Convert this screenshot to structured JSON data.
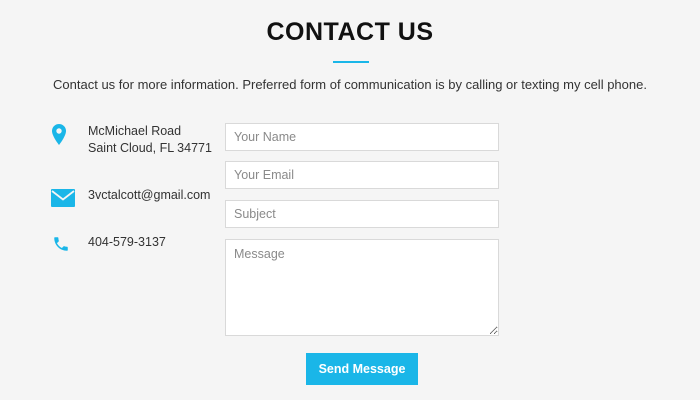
{
  "header": {
    "title": "CONTACT US",
    "subtitle": "Contact us for more information. Preferred form of communication is by calling or texting my cell phone."
  },
  "contact_info": {
    "address_line1": "McMichael Road",
    "address_line2": "Saint Cloud, FL 34771",
    "email": "3vctalcott@gmail.com",
    "phone": "404-579-3137"
  },
  "form": {
    "name_placeholder": "Your Name",
    "email_placeholder": "Your Email",
    "subject_placeholder": "Subject",
    "message_placeholder": "Message",
    "send_label": "Send Message"
  },
  "colors": {
    "accent": "#1ab6e8",
    "background": "#f5f5f5"
  },
  "icons": [
    "map-marker-icon",
    "envelope-icon",
    "phone-icon"
  ]
}
